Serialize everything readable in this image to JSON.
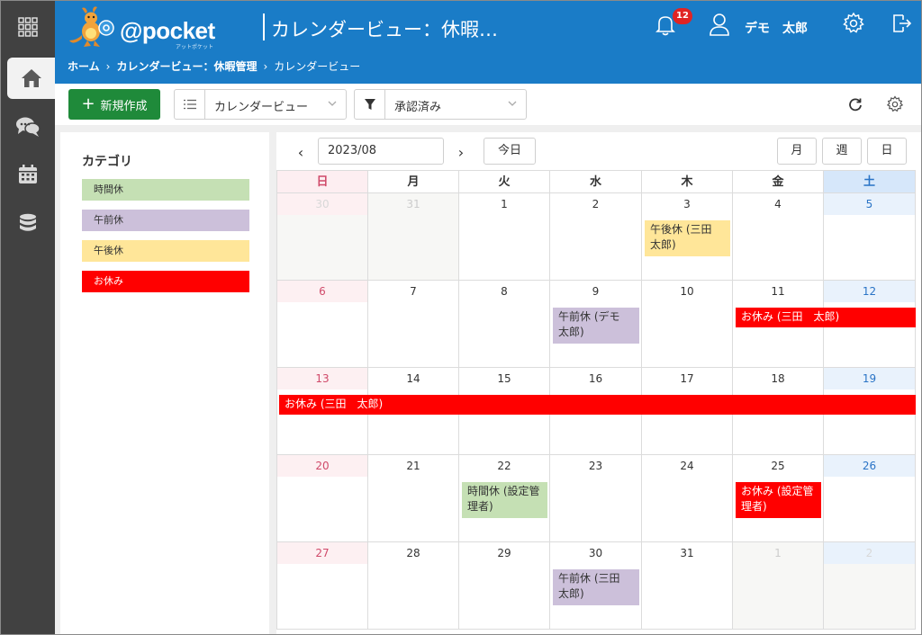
{
  "colors": {
    "rail": "#414141",
    "header": "#1a7cc7",
    "new_button": "#1f8a3a",
    "cat_jikankyu": "#c5e0b4",
    "cat_gozenkyu": "#ccc0da",
    "cat_gogokyu": "#ffe699",
    "cat_oyasumi": "#ff0000"
  },
  "rail": {
    "items": [
      {
        "name": "apps-grid-icon"
      },
      {
        "name": "home-icon"
      },
      {
        "name": "chat-icon"
      },
      {
        "name": "calendar-icon"
      },
      {
        "name": "database-icon"
      }
    ]
  },
  "header": {
    "logo_text": "@pocket",
    "logo_sub": "アットポケット",
    "app_title": "カレンダービュー：休暇…",
    "breadcrumb": [
      "ホーム",
      "カレンダービュー：休暇管理",
      "カレンダービュー"
    ],
    "notification_count": "12",
    "user_name": "デモ　太郎"
  },
  "toolbar": {
    "new_label": "新規作成",
    "view_select": "カレンダービュー",
    "filter_select": "承認済み"
  },
  "categories": {
    "title": "カテゴリ",
    "items": [
      {
        "label": "時間休",
        "color": "#c5e0b4",
        "text": "#333333"
      },
      {
        "label": "午前休",
        "color": "#ccc0da",
        "text": "#333333"
      },
      {
        "label": "午後休",
        "color": "#ffe699",
        "text": "#333333"
      },
      {
        "label": "お休み",
        "color": "#ff0000",
        "text": "#ffffff"
      }
    ]
  },
  "calendar": {
    "current_month": "2023/08",
    "today_label": "今日",
    "views": [
      "月",
      "週",
      "日"
    ],
    "weekdays": [
      "日",
      "月",
      "火",
      "水",
      "木",
      "金",
      "土"
    ],
    "weeks": [
      [
        "30",
        "31",
        "1",
        "2",
        "3",
        "4",
        "5"
      ],
      [
        "6",
        "7",
        "8",
        "9",
        "10",
        "11",
        "12"
      ],
      [
        "13",
        "14",
        "15",
        "16",
        "17",
        "18",
        "19"
      ],
      [
        "20",
        "21",
        "22",
        "23",
        "24",
        "25",
        "26"
      ],
      [
        "27",
        "28",
        "29",
        "30",
        "31",
        "1",
        "2"
      ]
    ],
    "other_month": [
      [
        true,
        true,
        false,
        false,
        false,
        false,
        false
      ],
      [
        false,
        false,
        false,
        false,
        false,
        false,
        false
      ],
      [
        false,
        false,
        false,
        false,
        false,
        false,
        false
      ],
      [
        false,
        false,
        false,
        false,
        false,
        false,
        false
      ],
      [
        false,
        false,
        false,
        false,
        false,
        true,
        true
      ]
    ],
    "events": [
      {
        "label": "午後休 (三田　太郎)",
        "week": 0,
        "day": 4,
        "span": 1,
        "category": "午後休"
      },
      {
        "label": "午前休 (デモ　太郎)",
        "week": 1,
        "day": 3,
        "span": 1,
        "category": "午前休"
      },
      {
        "label": "お休み (三田　太郎)",
        "week": 1,
        "day": 5,
        "span": 2,
        "category": "お休み"
      },
      {
        "label": "お休み (三田　太郎)",
        "week": 2,
        "day": 0,
        "span": 7,
        "category": "お休み"
      },
      {
        "label": "時間休 (設定管理者)",
        "week": 3,
        "day": 2,
        "span": 1,
        "category": "時間休"
      },
      {
        "label": "お休み (設定管理者)",
        "week": 3,
        "day": 5,
        "span": 1,
        "category": "お休み"
      },
      {
        "label": "午前休 (三田　太郎)",
        "week": 4,
        "day": 3,
        "span": 1,
        "category": "午前休"
      }
    ]
  }
}
